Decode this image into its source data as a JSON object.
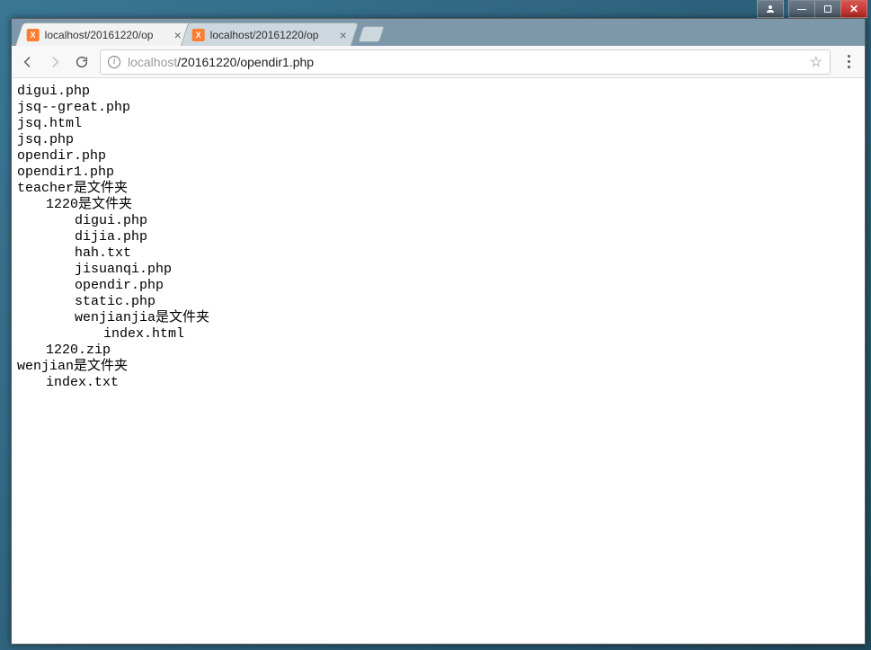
{
  "os": {
    "user_button": "user",
    "minimize": "minimize",
    "maximize": "maximize",
    "close": "close"
  },
  "tabs": [
    {
      "title": "localhost/20161220/op",
      "active": true
    },
    {
      "title": "localhost/20161220/op",
      "active": false
    }
  ],
  "toolbar": {
    "back": "Back",
    "forward": "Forward",
    "reload": "Reload",
    "site_info": "i",
    "url_host": "localhost",
    "url_path": "/20161220/opendir1.php",
    "star": "☆",
    "menu": "Menu"
  },
  "listing": [
    {
      "indent": 0,
      "text": "digui.php"
    },
    {
      "indent": 0,
      "text": "jsq--great.php"
    },
    {
      "indent": 0,
      "text": "jsq.html"
    },
    {
      "indent": 0,
      "text": "jsq.php"
    },
    {
      "indent": 0,
      "text": "opendir.php"
    },
    {
      "indent": 0,
      "text": "opendir1.php"
    },
    {
      "indent": 0,
      "text": "teacher是文件夹"
    },
    {
      "indent": 1,
      "text": "1220是文件夹"
    },
    {
      "indent": 2,
      "text": "digui.php"
    },
    {
      "indent": 2,
      "text": "dijia.php"
    },
    {
      "indent": 2,
      "text": "hah.txt"
    },
    {
      "indent": 2,
      "text": "jisuanqi.php"
    },
    {
      "indent": 2,
      "text": "opendir.php"
    },
    {
      "indent": 2,
      "text": "static.php"
    },
    {
      "indent": 2,
      "text": "wenjianjia是文件夹"
    },
    {
      "indent": 3,
      "text": "index.html"
    },
    {
      "indent": 1,
      "text": "1220.zip"
    },
    {
      "indent": 0,
      "text": "wenjian是文件夹"
    },
    {
      "indent": 1,
      "text": "index.txt"
    }
  ]
}
